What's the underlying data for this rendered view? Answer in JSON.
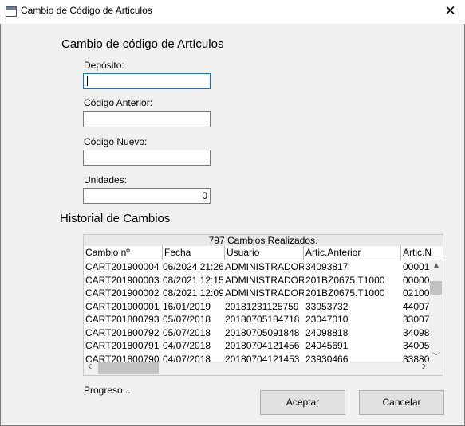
{
  "window": {
    "title": "Cambio de Código de Articulos",
    "close_glyph": "✕"
  },
  "form": {
    "heading": "Cambio de código de Artículos",
    "deposito": {
      "label": "Depósito:",
      "value": ""
    },
    "codigo_anterior": {
      "label": "Código Anterior:",
      "value": ""
    },
    "codigo_nuevo": {
      "label": "Código Nuevo:",
      "value": ""
    },
    "unidades": {
      "label": "Unidades:",
      "value": "0"
    }
  },
  "history": {
    "heading": "Historial de Cambios",
    "caption": "797 Cambios Realizados.",
    "columns": [
      "Cambio nº",
      "Fecha",
      "Usuario",
      "Artic.Anterior",
      "Artic.N"
    ],
    "rows": [
      [
        "CART201900004",
        "06/2024 21:26",
        "ADMINISTRADOR",
        "34093817",
        "00001"
      ],
      [
        "CART201900003",
        "08/2021 12:15",
        "ADMINISTRADOR",
        "201BZ0675.T1000",
        "00000"
      ],
      [
        "CART201900002",
        "08/2021 12:09",
        "ADMINISTRADOR",
        "201BZ0675.T1000",
        "02100"
      ],
      [
        "CART201900001",
        "16/01/2019",
        "20181231125759",
        "33053732",
        "44007"
      ],
      [
        "CART201800793",
        "05/07/2018",
        "20180705184718",
        "23047010",
        "33007"
      ],
      [
        "CART201800792",
        "05/07/2018",
        "20180705091848",
        "24098818",
        "34098"
      ],
      [
        "CART201800791",
        "04/07/2018",
        "20180704121456",
        "24045691",
        "34005"
      ],
      [
        "CART201800790",
        "04/07/2018",
        "20180704121453",
        "23930466",
        "33880"
      ]
    ]
  },
  "status": {
    "progress": "Progreso..."
  },
  "buttons": {
    "accept": "Aceptar",
    "cancel": "Cancelar"
  },
  "icons": {
    "up": "▲",
    "down": "﹀",
    "left": "‹",
    "right": "›"
  },
  "colors": {
    "focus_border": "#0078d7",
    "background": "#f0f0f0"
  }
}
